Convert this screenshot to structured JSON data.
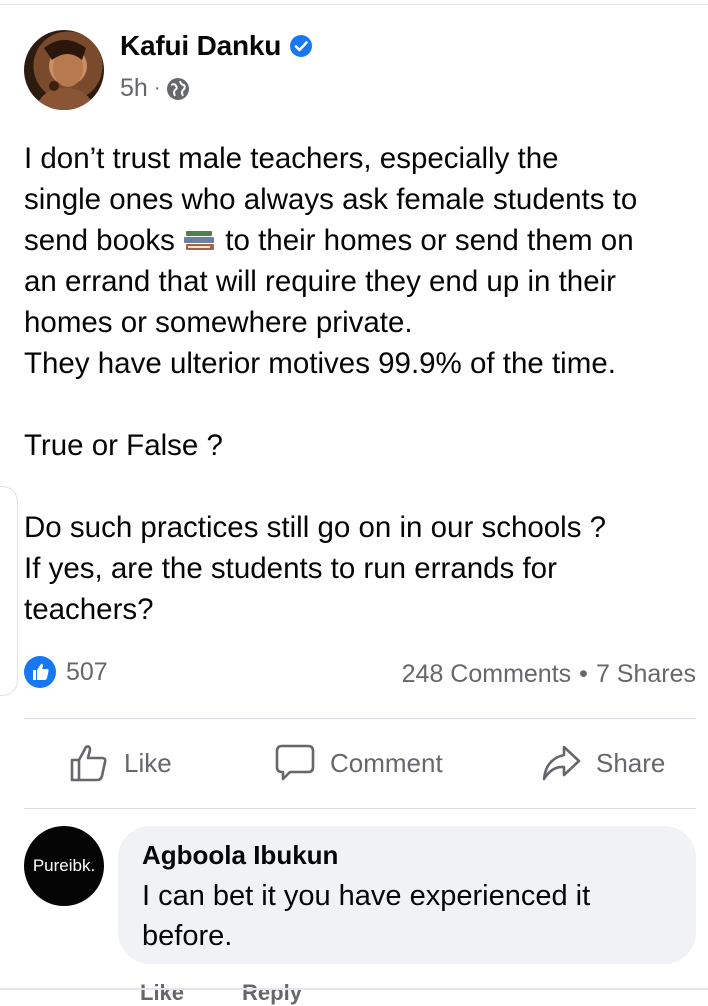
{
  "post": {
    "author": "Kafui Danku",
    "time": "5h",
    "separator": "·",
    "body": {
      "l1": "I don’t trust male teachers, especially the",
      "l2": "single ones who always ask female students to",
      "l3a": "send books",
      "l3b": " to their homes or send them on",
      "l4": "an errand that will require they end up in their",
      "l5": "homes or somewhere private.",
      "l6": "They have ulterior motives 99.9% of the time.",
      "l7": "True or False ?",
      "l8": "Do such practices still go on in our schools ?",
      "l9": "If yes, are the students to run errands for",
      "l10": "teachers?"
    },
    "reaction_count": "507",
    "comments": "248 Comments",
    "shares": "7 Shares",
    "stat_separator": "•"
  },
  "actions": {
    "like": "Like",
    "comment": "Comment",
    "share": "Share"
  },
  "comment": {
    "avatar_text": "Pureibk.",
    "author": "Agboola Ibukun",
    "text_l1": "I can bet it you have experienced it",
    "text_l2": "before.",
    "like": "Like",
    "reply": "Reply"
  },
  "colors": {
    "brand_blue": "#1877f2",
    "secondary_text": "#65676b",
    "comment_bg": "#f0f2f5"
  },
  "icons": [
    "verified-badge-icon",
    "globe-icon",
    "books-emoji-icon",
    "like-reaction-icon",
    "like-icon",
    "comment-icon",
    "share-icon"
  ]
}
